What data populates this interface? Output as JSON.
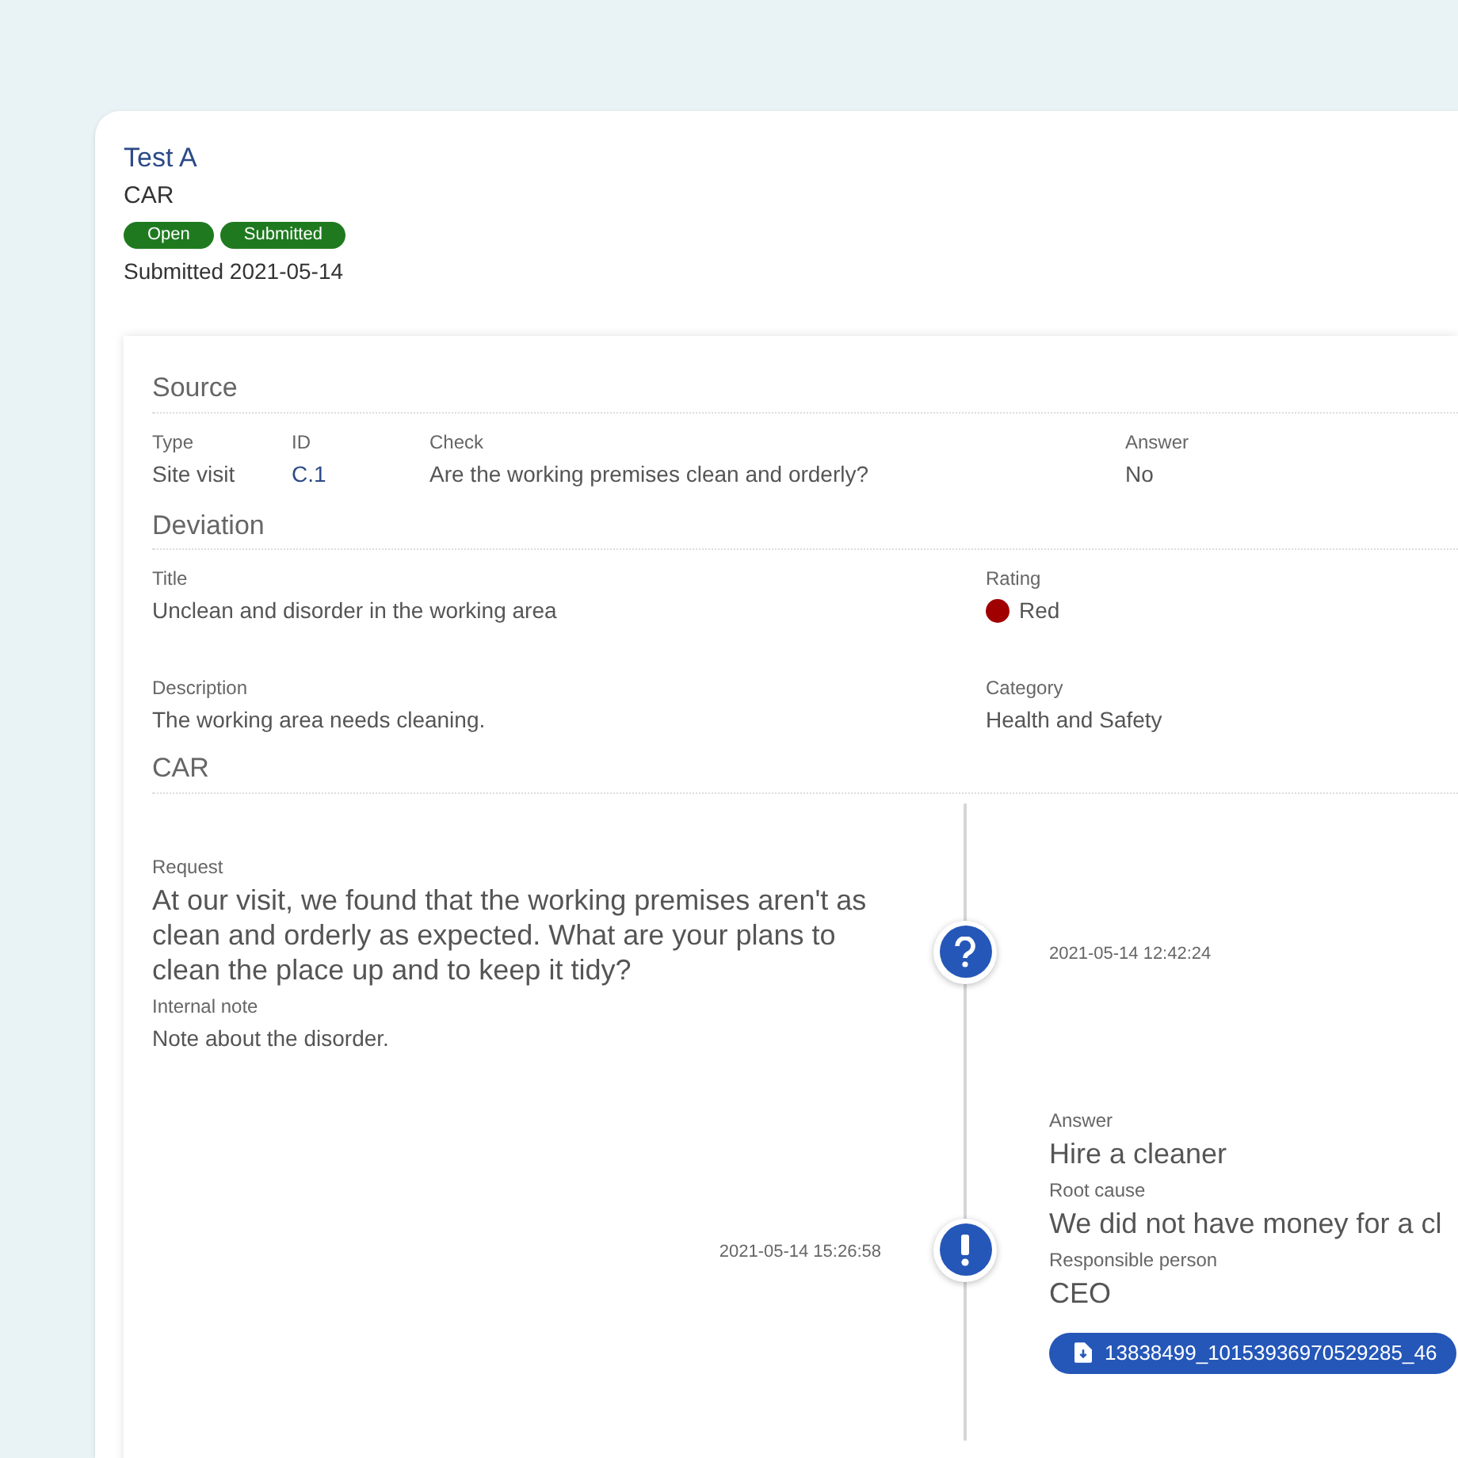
{
  "header": {
    "title": "Test A",
    "subtitle": "CAR",
    "badges": [
      {
        "label": "Open",
        "color": "#1f7a1f"
      },
      {
        "label": "Submitted",
        "color": "#1f7a1f"
      }
    ],
    "submitted": "Submitted 2021-05-14"
  },
  "source": {
    "heading": "Source",
    "type": {
      "label": "Type",
      "value": "Site visit"
    },
    "id": {
      "label": "ID",
      "value": "C.1"
    },
    "check": {
      "label": "Check",
      "value": "Are the working premises clean and orderly?"
    },
    "answer": {
      "label": "Answer",
      "value": "No"
    }
  },
  "deviation": {
    "heading": "Deviation",
    "title": {
      "label": "Title",
      "value": "Unclean and disorder in the working area"
    },
    "rating": {
      "label": "Rating",
      "value": "Red",
      "color": "#a00000"
    },
    "description": {
      "label": "Description",
      "value": "The working area needs cleaning."
    },
    "category": {
      "label": "Category",
      "value": "Health and Safety"
    }
  },
  "car": {
    "heading": "CAR",
    "timeline": [
      {
        "kind": "request",
        "time": "2021-05-14 12:42:24",
        "fields": [
          {
            "label": "Request",
            "value": "At our visit, we found that the working premises aren't as clean and orderly as expected. What are your plans to clean the place up and to keep it tidy?",
            "kind": "main"
          },
          {
            "label": "Internal note",
            "value": "Note about the disorder.",
            "kind": "note"
          }
        ]
      },
      {
        "kind": "answer",
        "time": "2021-05-14 15:26:58",
        "fields": [
          {
            "label": "Answer",
            "value": "Hire a cleaner",
            "kind": "main"
          },
          {
            "label": "Root cause",
            "value": "We did not have money for a cl",
            "kind": "main"
          },
          {
            "label": "Responsible person",
            "value": "CEO",
            "kind": "main"
          }
        ],
        "attachments": [
          "13838499_10153936970529285_46"
        ]
      }
    ]
  }
}
